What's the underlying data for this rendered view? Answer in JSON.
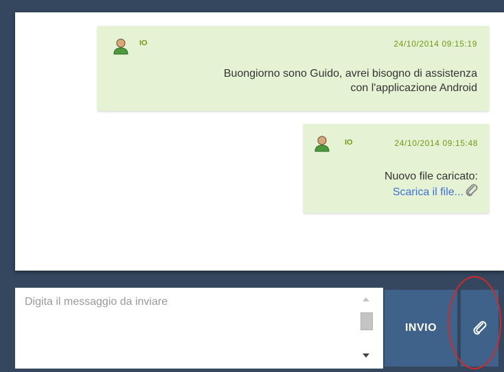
{
  "messages": [
    {
      "sender": "IO",
      "timestamp": "24/10/2014 09:15:19",
      "lines": [
        "Buongiorno sono Guido, avrei bisogno di assistenza",
        "con l'applicazione Android"
      ],
      "avatar_icon": "user-icon"
    },
    {
      "sender": "IO",
      "timestamp": "24/10/2014 09:15:48",
      "text": "Nuovo file caricato:",
      "link": "Scarica il file...",
      "link_icon": "paperclip-icon",
      "avatar_icon": "user-icon"
    }
  ],
  "composer": {
    "placeholder": "Digita il messaggio da inviare",
    "value": "",
    "send_label": "INVIO",
    "attach_icon": "paperclip-icon"
  },
  "colors": {
    "background": "#34475f",
    "bubble": "#e6f2d4",
    "meta_text": "#6e9a16",
    "link": "#3a73d4",
    "button": "#3e6289",
    "highlight": "#d42828"
  }
}
